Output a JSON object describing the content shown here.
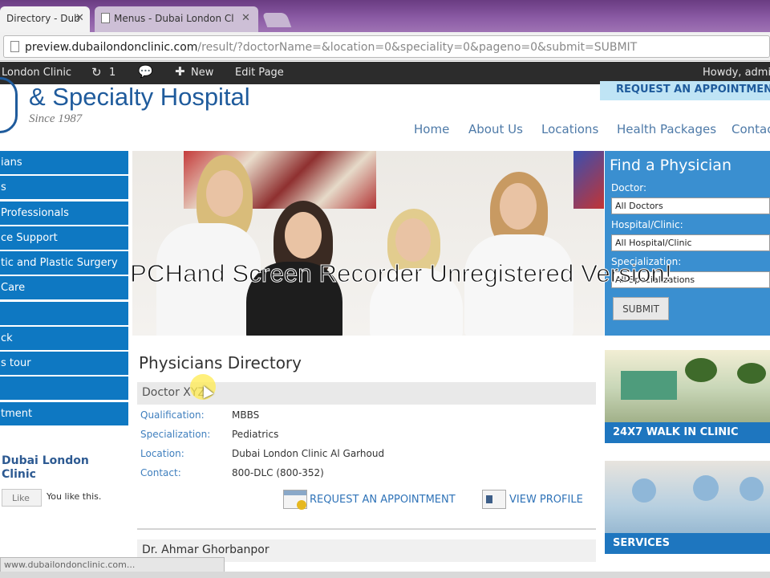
{
  "browser": {
    "tabs": [
      {
        "label": "Directory - Dub"
      },
      {
        "label": "Menus - Dubai London Cl"
      }
    ],
    "url_host": "preview.dubailondonclinic.com",
    "url_path": "/result/?doctorName=&location=0&speciality=0&pageno=0&submit=SUBMIT",
    "status_url": "www.dubailondonclinic.com..."
  },
  "adminbar": {
    "site": "London Clinic",
    "updates": "1",
    "new": "New",
    "edit": "Edit Page",
    "howdy": "Howdy, admi"
  },
  "header": {
    "logo_text": "& Specialty Hospital",
    "since": "Since 1987",
    "request_btn": "REQUEST AN APPOINTMENT",
    "nav": [
      "Home",
      "About Us",
      "Locations",
      "Health Packages",
      "Contac"
    ]
  },
  "sidebar": {
    "items": [
      "ians",
      "s",
      "Professionals",
      "ce Support",
      "tic and Plastic Surgery",
      "Care",
      "",
      "ck",
      "s tour",
      "",
      "tment"
    ],
    "fb_name": "Dubai London Clinic",
    "fb_like": "Like",
    "fb_you": "You like this."
  },
  "watermark": "PCHand Screen Recorder Unregistered Version!",
  "finder": {
    "title": "Find a Physician",
    "doctor_label": "Doctor:",
    "doctor_value": "All Doctors",
    "hospital_label": "Hospital/Clinic:",
    "hospital_value": "All Hospital/Clinic",
    "speciality_label": "Specialization:",
    "speciality_value": "All Specializations",
    "submit": "SUBMIT"
  },
  "directory": {
    "title": "Physicians Directory",
    "doctor_name": "Doctor XYZ",
    "fields": [
      {
        "label": "Qualification:",
        "value": "MBBS"
      },
      {
        "label": "Specialization:",
        "value": "Pediatrics"
      },
      {
        "label": "Location:",
        "value": "Dubai London Clinic Al Garhoud"
      },
      {
        "label": "Contact:",
        "value": "800-DLC (800-352)"
      }
    ],
    "request_link": "REQUEST AN APPOINTMENT",
    "profile_link": "VIEW PROFILE",
    "next_doctor": "Dr. Ahmar Ghorbanpor"
  },
  "promos": {
    "walkin": "24X7 WALK IN CLINIC",
    "services": "SERVICES"
  }
}
